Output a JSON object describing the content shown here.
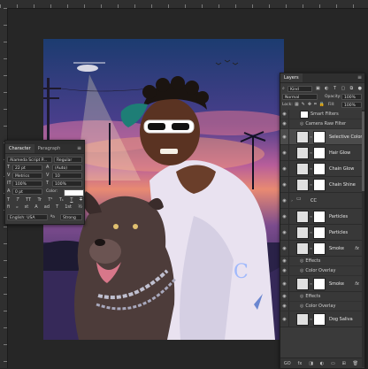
{
  "character_panel": {
    "tabs": [
      "Character",
      "Paragraph"
    ],
    "font_family": "Alameda Script P...",
    "font_style": "Regular",
    "font_size": "22 pt",
    "leading": "(Auto)",
    "kerning": "Metrics",
    "tracking": "10",
    "vscale": "100%",
    "hscale": "100%",
    "baseline_shift": "0 pt",
    "color_label": "Color:",
    "style_buttons": [
      "T",
      "T",
      "TT",
      "Tr",
      "T¹",
      "T₁",
      "T",
      "T"
    ],
    "opentype_buttons": [
      "fi",
      "ℴ",
      "st",
      "A",
      "ad",
      "T",
      "1st",
      "½"
    ],
    "language": "English: USA",
    "aa_label": "ªa",
    "antialias": "Strong"
  },
  "layers_panel": {
    "title": "Layers",
    "filter_kind": "Kind",
    "blend_mode": "Normal",
    "opacity_label": "Opacity:",
    "opacity_value": "100%",
    "lock_label": "Lock:",
    "fill_label": "Fill:",
    "fill_value": "100%",
    "rows": [
      {
        "name": "Smart Filters",
        "kind": "sub",
        "thumb": "mask"
      },
      {
        "name": "Camera Raw Filter",
        "kind": "sub",
        "thumb": "none"
      },
      {
        "name": "Selective Color 4",
        "kind": "adjust",
        "selected": true
      },
      {
        "name": "Hair Glow",
        "kind": "layer"
      },
      {
        "name": "Chain Glow",
        "kind": "layer"
      },
      {
        "name": "Chain Shine",
        "kind": "layer"
      },
      {
        "name": "CC",
        "kind": "group"
      },
      {
        "name": "Particles",
        "kind": "layer"
      },
      {
        "name": "Particles",
        "kind": "layer"
      },
      {
        "name": "Smoke",
        "kind": "layer",
        "fx": "fx"
      },
      {
        "name": "Effects",
        "kind": "sub"
      },
      {
        "name": "Color Overlay",
        "kind": "sub"
      },
      {
        "name": "Smoke",
        "kind": "layer",
        "fx": "fx"
      },
      {
        "name": "Effects",
        "kind": "sub"
      },
      {
        "name": "Color Overlay",
        "kind": "sub"
      },
      {
        "name": "Dog Saliva",
        "kind": "layer"
      }
    ],
    "footer_icons": [
      "link-icon",
      "fx-icon",
      "mask-add-icon",
      "adjustment-icon",
      "folder-icon",
      "new-layer-icon",
      "trash-icon"
    ],
    "footer_glyphs": [
      "GO",
      "fx",
      "◨",
      "◐",
      "▭",
      "⊞",
      "🗑"
    ]
  },
  "colors": {
    "app_bg": "#262626",
    "panel_bg": "#3a3a3a",
    "selected_row": "#4b4b4b",
    "text_color_swatch": "#ffffff"
  }
}
